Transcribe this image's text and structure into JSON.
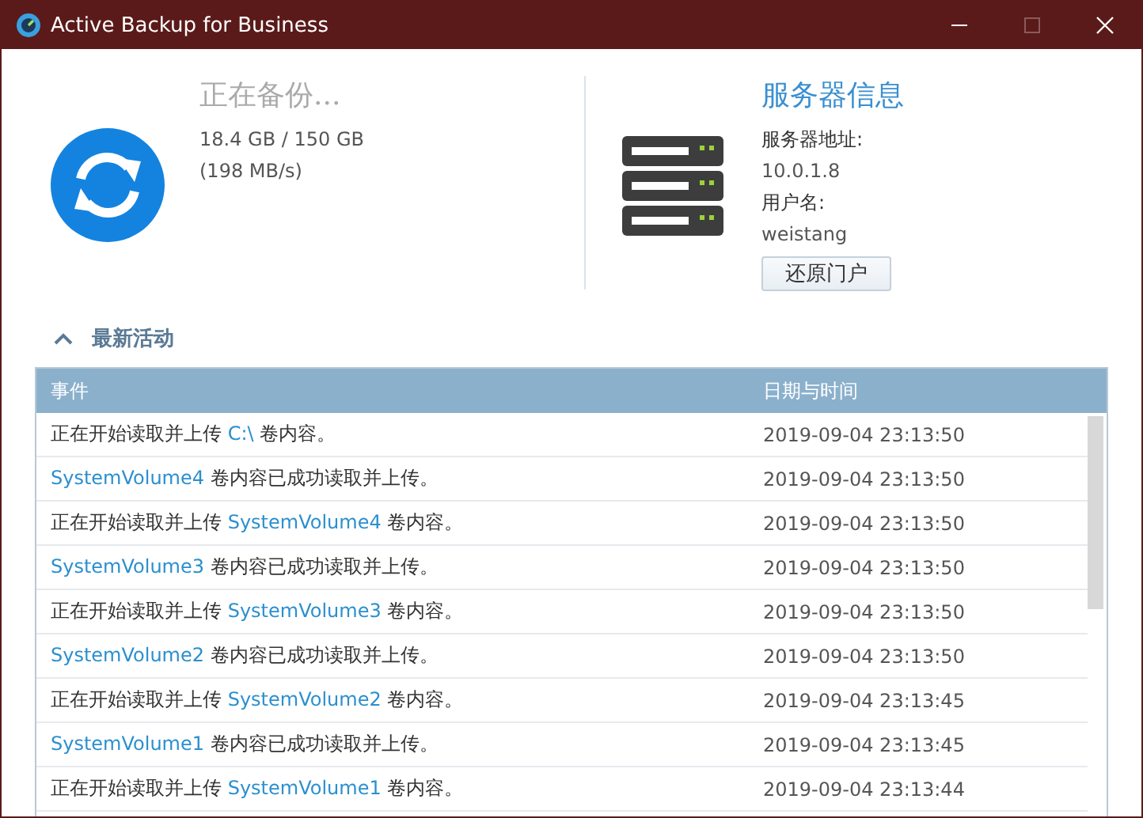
{
  "window": {
    "title": "Active Backup for Business"
  },
  "status": {
    "title": "正在备份...",
    "progress": "18.4 GB / 150 GB",
    "speed": "(198 MB/s)"
  },
  "server": {
    "title": "服务器信息",
    "address_label": "服务器地址:",
    "address": "10.0.1.8",
    "user_label": "用户名:",
    "user": "weistang",
    "button": "还原门户"
  },
  "activity": {
    "title": "最新活动",
    "expanded": true
  },
  "table": {
    "columns": [
      "事件",
      "日期与时间"
    ],
    "rows": [
      {
        "event": [
          {
            "text": "正在开始读取并上传 ",
            "kind": "plain"
          },
          {
            "text": "C:\\",
            "kind": "volume"
          },
          {
            "text": " 卷内容。",
            "kind": "plain"
          }
        ],
        "time": "2019-09-04 23:13:50"
      },
      {
        "event": [
          {
            "text": "SystemVolume4",
            "kind": "volume"
          },
          {
            "text": " 卷内容已成功读取并上传。",
            "kind": "plain"
          }
        ],
        "time": "2019-09-04 23:13:50"
      },
      {
        "event": [
          {
            "text": "正在开始读取并上传 ",
            "kind": "plain"
          },
          {
            "text": "SystemVolume4",
            "kind": "volume"
          },
          {
            "text": " 卷内容。",
            "kind": "plain"
          }
        ],
        "time": "2019-09-04 23:13:50"
      },
      {
        "event": [
          {
            "text": "SystemVolume3",
            "kind": "volume"
          },
          {
            "text": " 卷内容已成功读取并上传。",
            "kind": "plain"
          }
        ],
        "time": "2019-09-04 23:13:50"
      },
      {
        "event": [
          {
            "text": "正在开始读取并上传 ",
            "kind": "plain"
          },
          {
            "text": "SystemVolume3",
            "kind": "volume"
          },
          {
            "text": " 卷内容。",
            "kind": "plain"
          }
        ],
        "time": "2019-09-04 23:13:50"
      },
      {
        "event": [
          {
            "text": "SystemVolume2",
            "kind": "volume"
          },
          {
            "text": " 卷内容已成功读取并上传。",
            "kind": "plain"
          }
        ],
        "time": "2019-09-04 23:13:50"
      },
      {
        "event": [
          {
            "text": "正在开始读取并上传 ",
            "kind": "plain"
          },
          {
            "text": "SystemVolume2",
            "kind": "volume"
          },
          {
            "text": " 卷内容。",
            "kind": "plain"
          }
        ],
        "time": "2019-09-04 23:13:45"
      },
      {
        "event": [
          {
            "text": "SystemVolume1",
            "kind": "volume"
          },
          {
            "text": " 卷内容已成功读取并上传。",
            "kind": "plain"
          }
        ],
        "time": "2019-09-04 23:13:45"
      },
      {
        "event": [
          {
            "text": "正在开始读取并上传 ",
            "kind": "plain"
          },
          {
            "text": "SystemVolume1",
            "kind": "volume"
          },
          {
            "text": " 卷内容。",
            "kind": "plain"
          }
        ],
        "time": "2019-09-04 23:13:44"
      }
    ]
  }
}
